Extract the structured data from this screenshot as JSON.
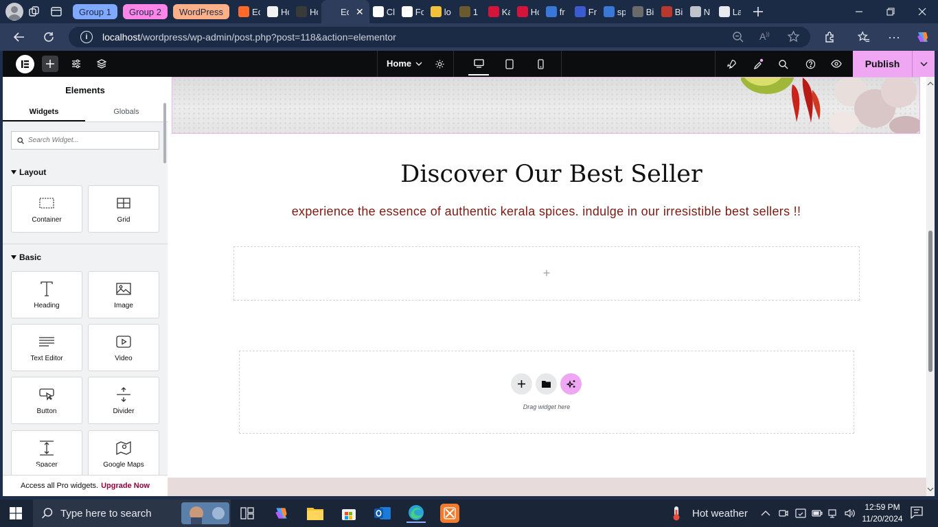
{
  "browser": {
    "tab_groups": [
      {
        "label": "Group 1",
        "color": "#7fa8ff"
      },
      {
        "label": "Group 2",
        "color": "#ff86e8"
      },
      {
        "label": "WordPress",
        "color": "#ffb089"
      }
    ],
    "tabs": [
      {
        "text": "Ec",
        "color": "#ff6a2b"
      },
      {
        "text": "Hc",
        "color": "#f2f2f2"
      },
      {
        "text": "Hc",
        "color": "#3a3a3a"
      },
      {
        "text": "Ed",
        "color": "#2d3d5b",
        "active": true
      },
      {
        "text": "Cl",
        "color": "#ffffff"
      },
      {
        "text": "Fc",
        "color": "#ffffff"
      },
      {
        "text": "lo",
        "color": "#f3c23a"
      },
      {
        "text": "1",
        "color": "#6a5a2e"
      },
      {
        "text": "Ka",
        "color": "#d4143a"
      },
      {
        "text": "Hc",
        "color": "#d4143a"
      },
      {
        "text": "fr",
        "color": "#3a78d8"
      },
      {
        "text": "Fr",
        "color": "#3c5bd0"
      },
      {
        "text": "sp",
        "color": "#3a78d8"
      },
      {
        "text": "Bi",
        "color": "#6a6a6a"
      },
      {
        "text": "Bi",
        "color": "#b8382e"
      },
      {
        "text": "N",
        "color": "#bfc3ca"
      },
      {
        "text": "La",
        "color": "#e8eaee"
      }
    ],
    "url_host": "localhost",
    "url_path": "/wordpress/wp-admin/post.php?post=118&action=elementor"
  },
  "editor": {
    "page_selector": "Home",
    "publish_label": "Publish"
  },
  "panel": {
    "title": "Elements",
    "tabs": [
      "Widgets",
      "Globals"
    ],
    "search_placeholder": "Search Widget...",
    "layout_title": "Layout",
    "basic_title": "Basic",
    "widgets": {
      "container": "Container",
      "grid": "Grid",
      "heading": "Heading",
      "image": "Image",
      "text_editor": "Text Editor",
      "video": "Video",
      "button": "Button",
      "divider": "Divider",
      "spacer": "Spacer",
      "google_maps": "Google Maps"
    },
    "pro_text": "Access all Pro widgets.",
    "pro_link": "Upgrade Now"
  },
  "canvas": {
    "headline": "Discover Our Best Seller",
    "subline": "experience the essence of authentic kerala spices. indulge in our irresistible best sellers !!",
    "empty_plus": "+",
    "drop_text": "Drag widget here"
  },
  "taskbar": {
    "search_placeholder": "Type here to search",
    "weather": "Hot weather",
    "time": "12:59 PM",
    "date": "11/20/2024"
  },
  "colors": {
    "accent_pink": "#f0a7f3",
    "subline_red": "#7b1a12",
    "upgrade_link": "#93003f"
  }
}
